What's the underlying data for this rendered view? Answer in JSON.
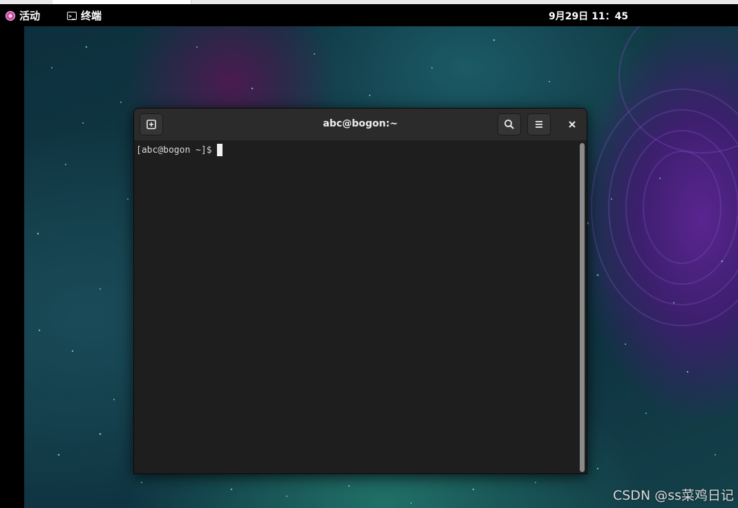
{
  "topbar": {
    "activities_label": "活动",
    "app_name": "终端",
    "clock": "9月29日  11：45"
  },
  "terminal": {
    "title": "abc@bogon:~",
    "prompt": "[abc@bogon ~]$",
    "icons": {
      "new_tab": "new-tab-icon",
      "search": "search-icon",
      "menu": "hamburger-menu-icon",
      "close": "close-icon"
    }
  },
  "desktop": {
    "watermark": "CSDN @ss菜鸡日记"
  }
}
